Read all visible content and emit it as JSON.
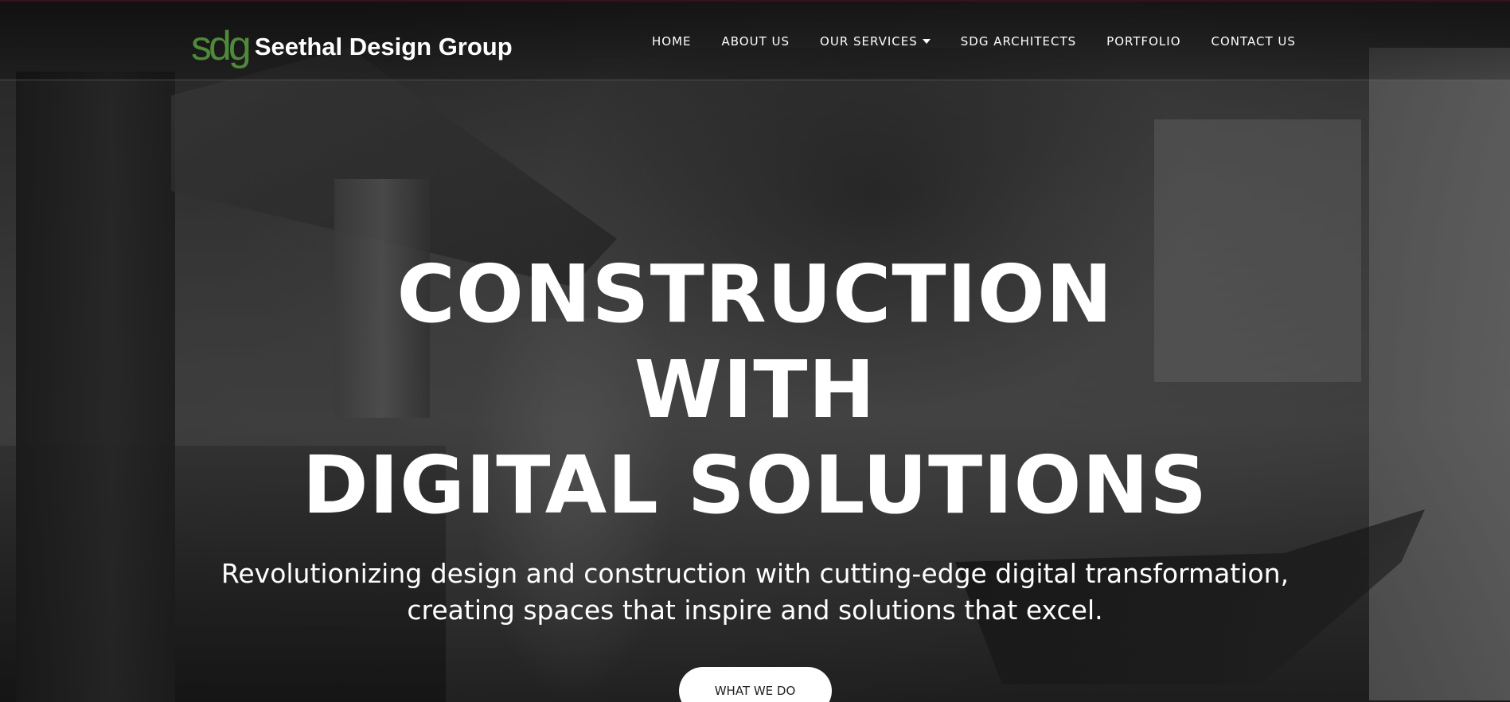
{
  "header": {
    "logo_mark": "sdg",
    "logo_text": "Seethal Design Group"
  },
  "nav": {
    "items": [
      {
        "label": "HOME"
      },
      {
        "label": "ABOUT US"
      },
      {
        "label": "OUR SERVICES",
        "has_dropdown": true
      },
      {
        "label": "SDG ARCHITECTS"
      },
      {
        "label": "PORTFOLIO"
      },
      {
        "label": "CONTACT US"
      }
    ]
  },
  "hero": {
    "title_line1": "CONSTRUCTION WITH",
    "title_line2": "DIGITAL SOLUTIONS",
    "subtitle": "Revolutionizing design and construction with cutting-edge digital transformation, creating spaces that inspire and solutions that excel.",
    "cta_label": "WHAT WE DO"
  },
  "colors": {
    "logo_green": "#4f8a3a",
    "text": "#ffffff",
    "button_bg": "#ffffff",
    "button_text": "#222222"
  },
  "icons": {
    "dropdown": "caret-down-icon"
  }
}
